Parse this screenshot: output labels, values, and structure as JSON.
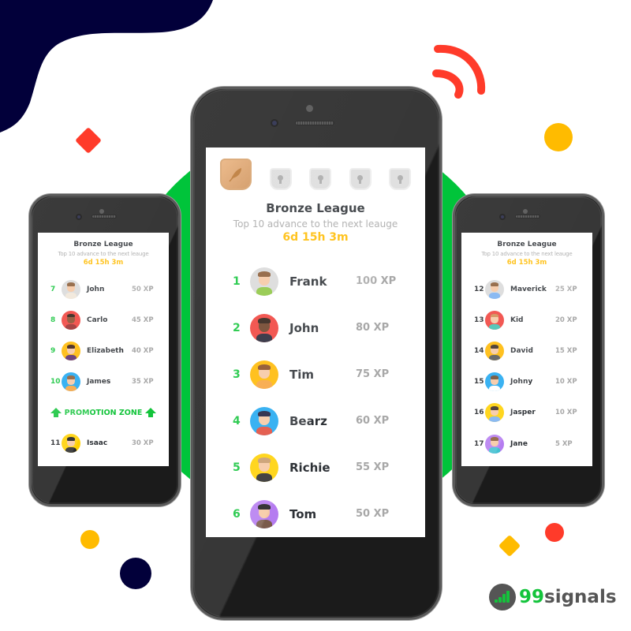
{
  "colors": {
    "green": "#13c43b",
    "navy": "#02003a",
    "red": "#ff3b2a",
    "yellow": "#ffbb00",
    "xp_gray": "#a8a8a8",
    "name_dark": "#2d3136"
  },
  "league": {
    "title": "Bronze League",
    "subtitle": "Top 10 advance to the next leauge",
    "countdown": "6d 15h 3m"
  },
  "badges": [
    {
      "icon": "bronze-feather-badge",
      "state": "unlocked"
    },
    {
      "icon": "locked-badge",
      "state": "locked"
    },
    {
      "icon": "locked-badge",
      "state": "locked"
    },
    {
      "icon": "locked-badge",
      "state": "locked"
    },
    {
      "icon": "locked-badge",
      "state": "locked"
    }
  ],
  "main_leaderboard": [
    {
      "rank": "1",
      "name": "Frank",
      "xp": "100 XP",
      "avatar_bg": "#d9d9d9",
      "hair": "#8a5a34",
      "shirt": "#8cc63f"
    },
    {
      "rank": "2",
      "name": "John",
      "xp": "80 XP",
      "avatar_bg": "#f0403a",
      "hair": "#2b1a10",
      "shirt": "#222233",
      "skin": "#6b3e24"
    },
    {
      "rank": "3",
      "name": "Tim",
      "xp": "75 XP",
      "avatar_bg": "#ffb800",
      "hair": "#8a4a20",
      "shirt": "#f7a33c"
    },
    {
      "rank": "4",
      "name": "Bearz",
      "xp": "60 XP",
      "avatar_bg": "#1ea7f0",
      "hair": "#1a1a3a",
      "shirt": "#e0493a"
    },
    {
      "rank": "5",
      "name": "Richie",
      "xp": "55 XP",
      "avatar_bg": "#ffd000",
      "hair": "#c79a6a",
      "shirt": "#2a2a2a"
    },
    {
      "rank": "6",
      "name": "Tom",
      "xp": "50 XP",
      "avatar_bg": "#b57cf0",
      "hair": "#1a1a1a",
      "shirt": "#7a5a4a"
    }
  ],
  "left_leaderboard": [
    {
      "rank": "7",
      "name": "John",
      "xp": "50 XP",
      "avatar_bg": "#d9d9d9",
      "hair": "#8a5a34",
      "shirt": "#f0e6d8"
    },
    {
      "rank": "8",
      "name": "Carlo",
      "xp": "45 XP",
      "avatar_bg": "#f0403a",
      "hair": "#2b1a10",
      "shirt": "#9a2a2a",
      "skin": "#8a4a2a"
    },
    {
      "rank": "9",
      "name": "Elizabeth",
      "xp": "40 XP",
      "avatar_bg": "#ffb800",
      "hair": "#3a1a10",
      "shirt": "#5a2a6a"
    },
    {
      "rank": "10",
      "name": "James",
      "xp": "35 XP",
      "avatar_bg": "#1ea7f0",
      "hair": "#8a5a34",
      "shirt": "#f7a33c"
    }
  ],
  "promotion_zone": {
    "label": "PROMOTION ZONE"
  },
  "left_below_zone": [
    {
      "rank": "11",
      "name": "Isaac",
      "xp": "30 XP",
      "avatar_bg": "#ffd000",
      "hair": "#1a1a1a",
      "shirt": "#2a2a2a"
    }
  ],
  "right_leaderboard": [
    {
      "rank": "12",
      "name": "Maverick",
      "xp": "25 XP",
      "avatar_bg": "#d9d9d9",
      "hair": "#8a5a34",
      "shirt": "#7ab0f0"
    },
    {
      "rank": "13",
      "name": "Kid",
      "xp": "20 XP",
      "avatar_bg": "#f0403a",
      "hair": "#d08a50",
      "shirt": "#40c0b0"
    },
    {
      "rank": "14",
      "name": "David",
      "xp": "15 XP",
      "avatar_bg": "#ffb800",
      "hair": "#3a2a20",
      "shirt": "#555555"
    },
    {
      "rank": "15",
      "name": "Johny",
      "xp": "10 XP",
      "avatar_bg": "#1ea7f0",
      "hair": "#6a4a30",
      "shirt": "#ffffff"
    },
    {
      "rank": "16",
      "name": "Jasper",
      "xp": "10 XP",
      "avatar_bg": "#ffd000",
      "hair": "#3a2a20",
      "shirt": "#7ab0f0"
    },
    {
      "rank": "17",
      "name": "Jane",
      "xp": "5 XP",
      "avatar_bg": "#b57cf0",
      "hair": "#8a5a34",
      "shirt": "#40c0d0"
    }
  ],
  "logo": {
    "number": "99",
    "text": "signals"
  }
}
